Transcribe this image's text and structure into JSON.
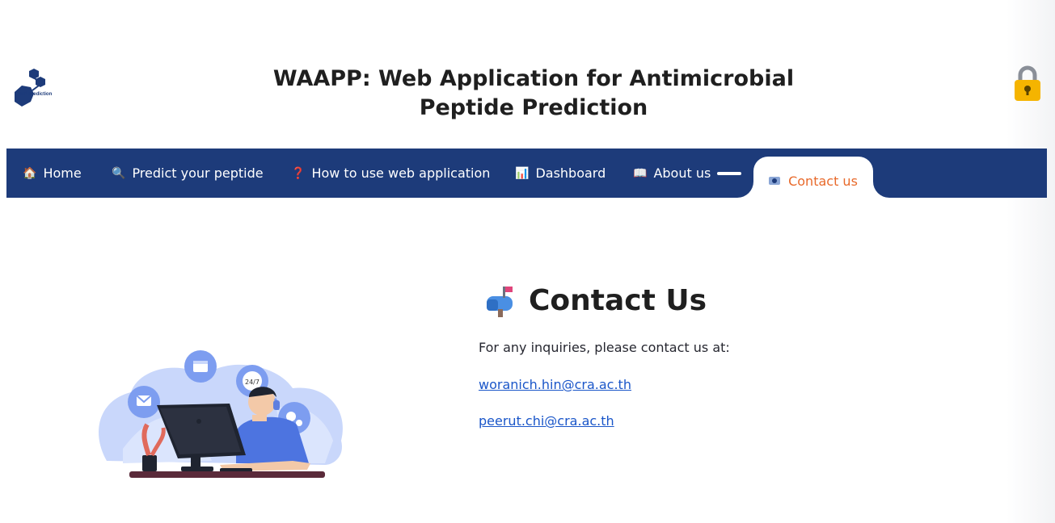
{
  "header": {
    "logo_text": "AMP Prediction",
    "title": "WAAPP: Web Application for Antimicrobial Peptide Prediction",
    "lock_icon": "lock-icon"
  },
  "navbar": {
    "background": "#1d3b7a",
    "active_color": "#e8692a",
    "items": [
      {
        "label": "Home",
        "icon": "house-icon",
        "glyph": "🏠"
      },
      {
        "label": "Predict your peptide",
        "icon": "magnifier-icon",
        "glyph": "🔍"
      },
      {
        "label": "How to use web application",
        "icon": "question-icon",
        "glyph": "❓"
      },
      {
        "label": "Dashboard",
        "icon": "bar-chart-icon",
        "glyph": "📊"
      },
      {
        "label": "About us",
        "icon": "book-icon",
        "glyph": "📖"
      },
      {
        "label": "Contact us",
        "icon": "id-card-icon",
        "active": true
      }
    ]
  },
  "contact": {
    "heading": "Contact Us",
    "heading_icon": "mailbox-icon",
    "intro": "For any inquiries, please contact us at:",
    "emails": [
      "woranich.hin@cra.ac.th",
      "peerut.chi@cra.ac.th"
    ]
  },
  "illustration": "customer-support-illustration"
}
